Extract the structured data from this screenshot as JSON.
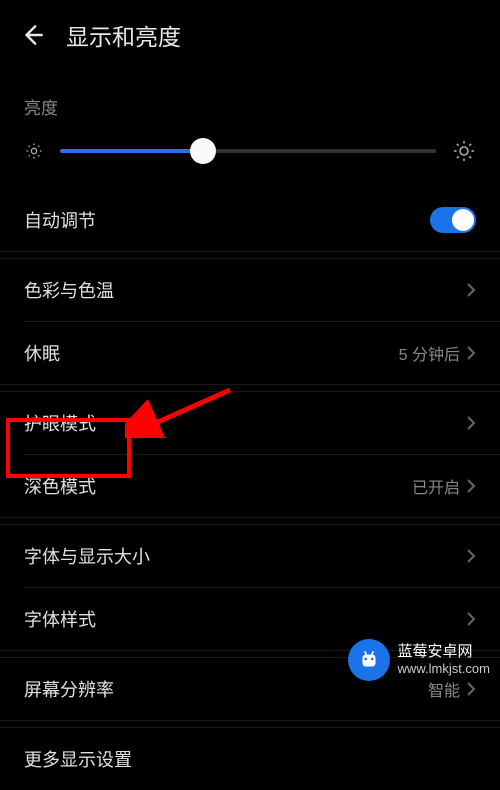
{
  "header": {
    "title": "显示和亮度"
  },
  "brightness": {
    "section_label": "亮度",
    "value_percent": 38
  },
  "auto_adjust": {
    "label": "自动调节",
    "enabled": true
  },
  "rows": {
    "color_temp": {
      "label": "色彩与色温",
      "value": ""
    },
    "sleep": {
      "label": "休眠",
      "value": "5 分钟后"
    },
    "eye_comfort": {
      "label": "护眼模式",
      "value": ""
    },
    "dark_mode": {
      "label": "深色模式",
      "value": "已开启"
    },
    "font_display_size": {
      "label": "字体与显示大小",
      "value": ""
    },
    "font_style": {
      "label": "字体样式",
      "value": ""
    },
    "screen_resolution": {
      "label": "屏幕分辨率",
      "value": "智能"
    },
    "more_display": {
      "label": "更多显示设置",
      "value": ""
    }
  },
  "watermark": {
    "title": "蓝莓安卓网",
    "url": "www.lmkjst.com"
  }
}
